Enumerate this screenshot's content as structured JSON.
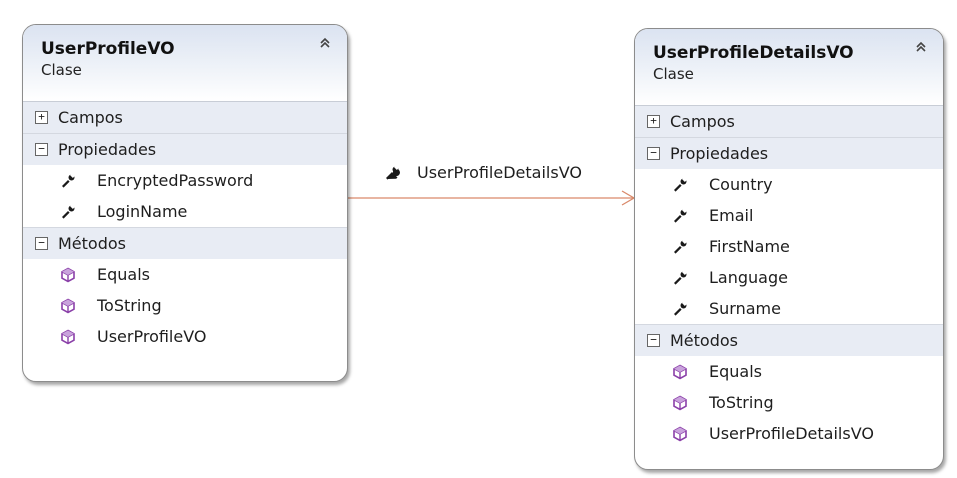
{
  "classes": [
    {
      "name": "UserProfileVO",
      "kind": "Clase",
      "groups": [
        {
          "label": "Campos",
          "toggle": "+",
          "items": []
        },
        {
          "label": "Propiedades",
          "toggle": "−",
          "items": [
            {
              "label": "EncryptedPassword",
              "icon": "property-wrench-icon"
            },
            {
              "label": "LoginName",
              "icon": "property-wrench-icon"
            }
          ]
        },
        {
          "label": "Métodos",
          "toggle": "−",
          "items": [
            {
              "label": "Equals",
              "icon": "method-cube-icon"
            },
            {
              "label": "ToString",
              "icon": "method-cube-icon"
            },
            {
              "label": "UserProfileVO",
              "icon": "method-cube-icon"
            }
          ]
        }
      ]
    },
    {
      "name": "UserProfileDetailsVO",
      "kind": "Clase",
      "groups": [
        {
          "label": "Campos",
          "toggle": "+",
          "items": []
        },
        {
          "label": "Propiedades",
          "toggle": "−",
          "items": [
            {
              "label": "Country",
              "icon": "property-wrench-icon"
            },
            {
              "label": "Email",
              "icon": "property-wrench-icon"
            },
            {
              "label": "FirstName",
              "icon": "property-wrench-icon"
            },
            {
              "label": "Language",
              "icon": "property-wrench-icon"
            },
            {
              "label": "Surname",
              "icon": "property-wrench-icon"
            }
          ]
        },
        {
          "label": "Métodos",
          "toggle": "−",
          "items": [
            {
              "label": "Equals",
              "icon": "method-cube-icon"
            },
            {
              "label": "ToString",
              "icon": "method-cube-icon"
            },
            {
              "label": "UserProfileDetailsVO",
              "icon": "method-cube-icon"
            }
          ]
        }
      ]
    }
  ],
  "association": {
    "label": "UserProfileDetailsVO",
    "icon": "property-wrench-icon",
    "color": "#d9896a"
  },
  "colors": {
    "header_gradient_top": "#dbe3f1",
    "group_band": "#e8ecf4",
    "method_icon": "#8a3fa8"
  }
}
